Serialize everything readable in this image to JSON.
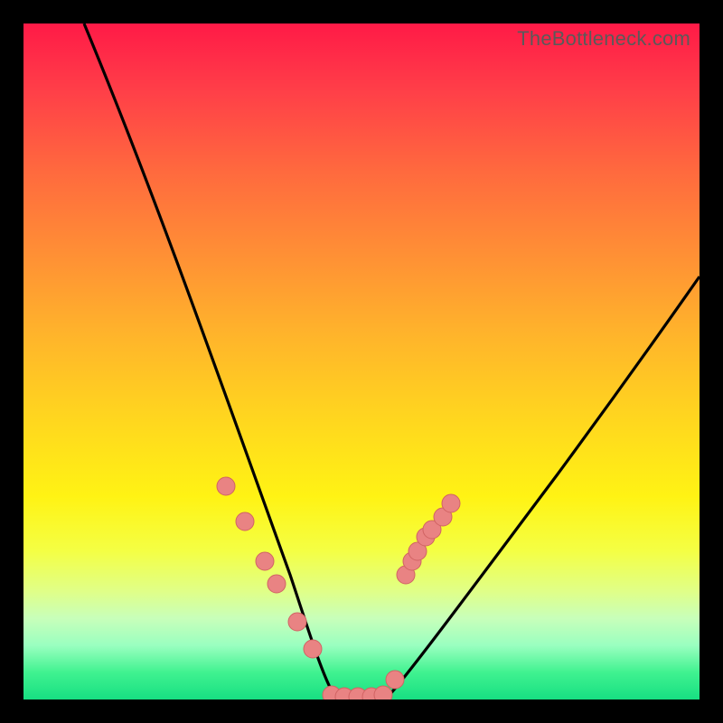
{
  "watermark": {
    "text": "TheBottleneck.com"
  },
  "chart_data": {
    "type": "line",
    "title": "",
    "xlabel": "",
    "ylabel": "",
    "xlim": [
      0,
      100
    ],
    "ylim": [
      0,
      100
    ],
    "grid": false,
    "legend": false,
    "series": [
      {
        "name": "curve-left",
        "x": [
          9,
          15,
          20,
          25,
          30,
          34,
          37,
          40,
          42,
          44,
          46
        ],
        "y": [
          100,
          85,
          70,
          55,
          40,
          28,
          20,
          12,
          6,
          2,
          0
        ]
      },
      {
        "name": "flat-bottom",
        "x": [
          46,
          48,
          50,
          52,
          54
        ],
        "y": [
          0,
          0,
          0,
          0,
          0
        ]
      },
      {
        "name": "curve-right",
        "x": [
          54,
          58,
          63,
          70,
          78,
          87,
          95,
          100
        ],
        "y": [
          0,
          3,
          8,
          17,
          29,
          43,
          56,
          64
        ]
      }
    ],
    "markers": [
      {
        "name": "left-dots",
        "x": [
          30.0,
          32.8,
          35.7,
          37.5,
          40.5,
          42.8
        ],
        "y": [
          31.5,
          26.3,
          20.5,
          17.0,
          11.5,
          7.5
        ]
      },
      {
        "name": "bottom-dots",
        "x": [
          45.6,
          47.5,
          49.5,
          51.5,
          53.2
        ],
        "y": [
          0.7,
          0.35,
          0.35,
          0.35,
          0.7
        ]
      },
      {
        "name": "right-dots",
        "x": [
          56.5,
          57.5,
          58.3,
          59.5,
          60.5,
          62.0,
          63.2
        ],
        "y": [
          18.5,
          20.5,
          22.0,
          24.0,
          25.0,
          27.0,
          29.0
        ]
      },
      {
        "name": "bottom-extra",
        "x": [
          55.0
        ],
        "y": [
          3.0
        ]
      }
    ],
    "colors": {
      "curve": "#000000",
      "marker_fill": "#e98383",
      "marker_stroke": "#d16363"
    }
  }
}
